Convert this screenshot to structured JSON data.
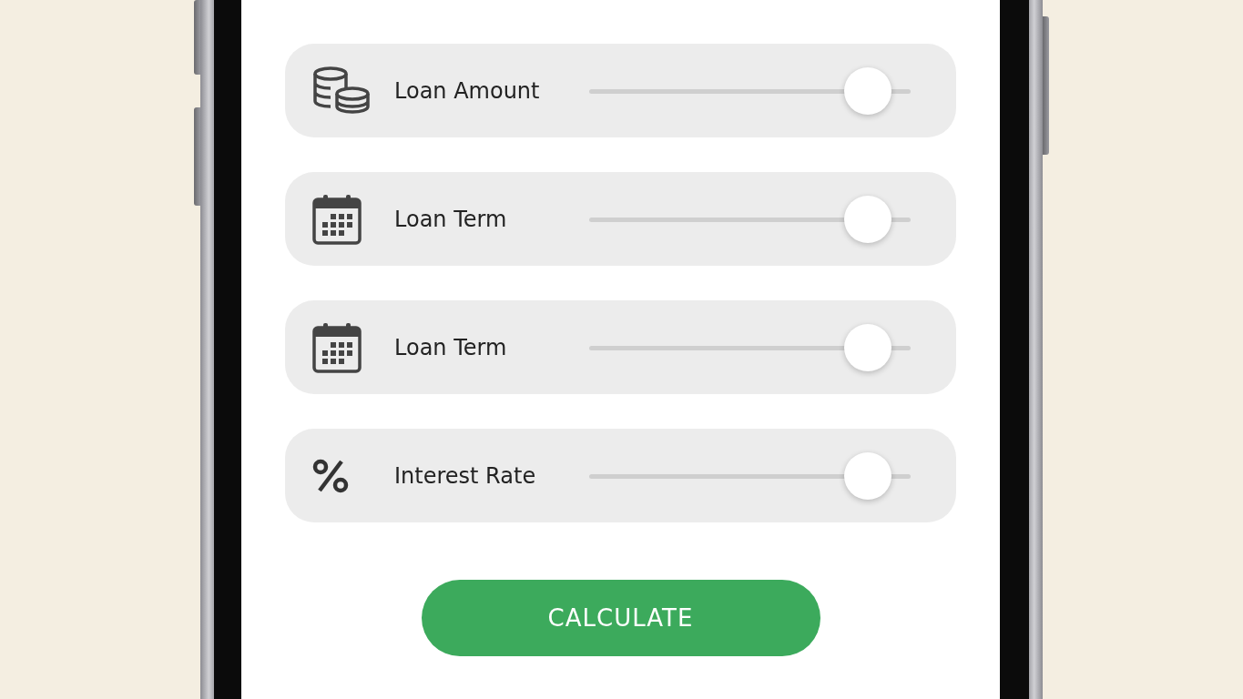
{
  "rows": [
    {
      "kind": "coins",
      "label": "Loan Amount",
      "level": 0.93
    },
    {
      "kind": "calendar",
      "label": "Loan Term",
      "level": 0.93
    },
    {
      "kind": "calendar",
      "label": "Loan Term",
      "level": 0.93
    },
    {
      "kind": "percent",
      "label": "Interest Rate",
      "level": 0.93
    }
  ],
  "button": {
    "label": "CALCULATE"
  }
}
